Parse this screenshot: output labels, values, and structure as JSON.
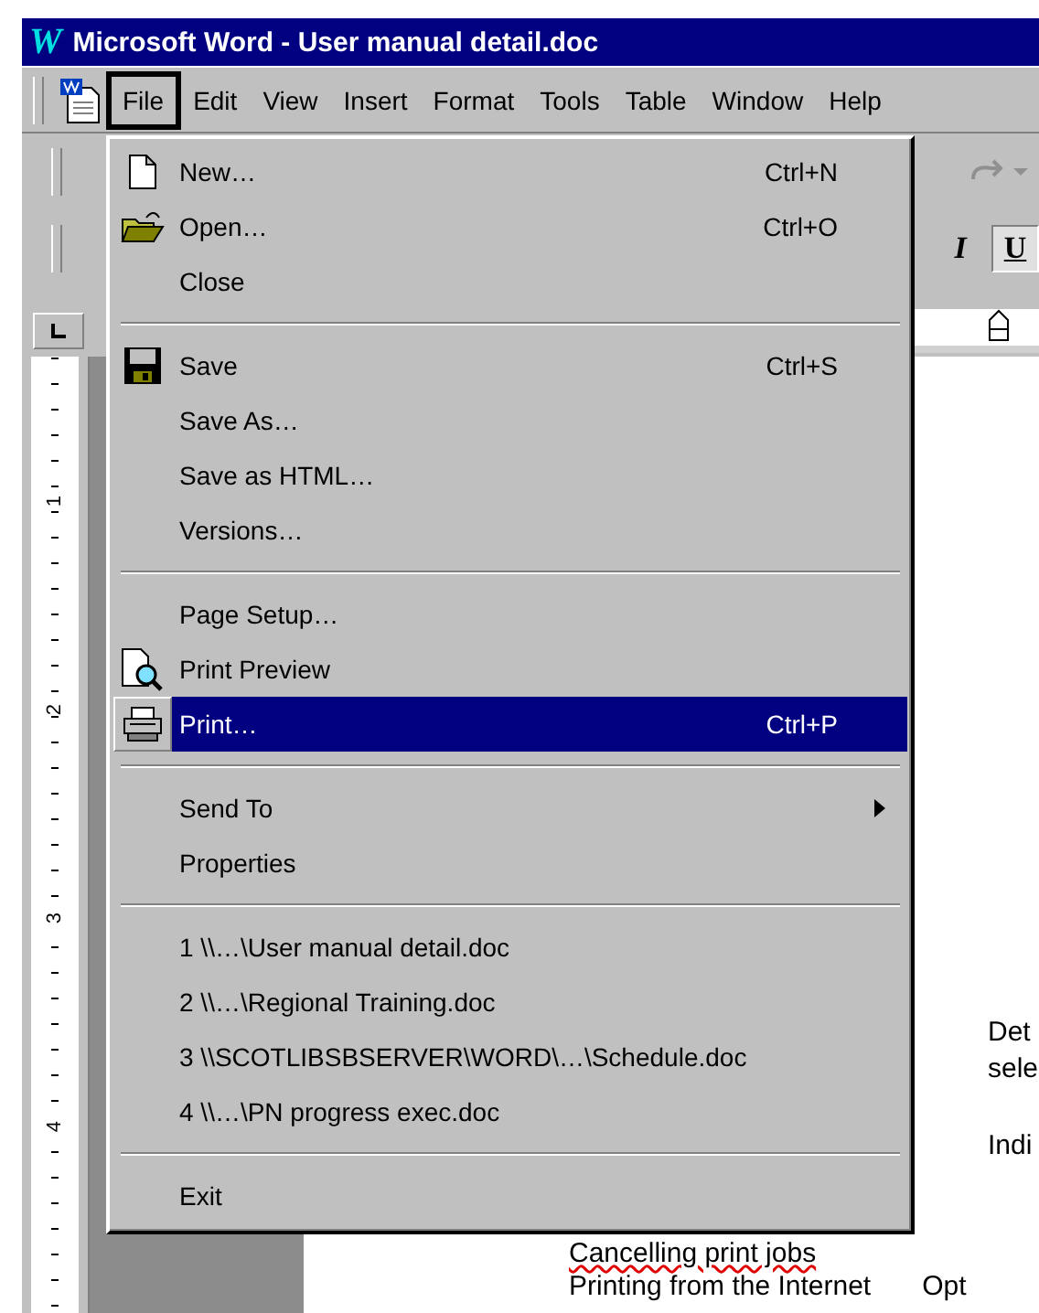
{
  "window": {
    "logo": "W",
    "title": "Microsoft Word - User manual detail.doc"
  },
  "menu_bar": [
    {
      "label": "File",
      "selected": true
    },
    {
      "label": "Edit",
      "selected": false
    },
    {
      "label": "View",
      "selected": false
    },
    {
      "label": "Insert",
      "selected": false
    },
    {
      "label": "Format",
      "selected": false
    },
    {
      "label": "Tools",
      "selected": false
    },
    {
      "label": "Table",
      "selected": false
    },
    {
      "label": "Window",
      "selected": false
    },
    {
      "label": "Help",
      "selected": false
    }
  ],
  "toolbar": {
    "format_buttons": [
      {
        "label": "I",
        "selected": false
      },
      {
        "label": "U",
        "selected": true
      }
    ]
  },
  "vertical_ruler": [
    "1",
    "2",
    "3",
    "4"
  ],
  "file_menu": {
    "groups": [
      [
        {
          "kind": "command",
          "label": "New…",
          "shortcut": "Ctrl+N",
          "selected": false
        },
        {
          "kind": "command",
          "label": "Open…",
          "shortcut": "Ctrl+O",
          "selected": false
        },
        {
          "kind": "command",
          "label": "Close",
          "selected": false
        }
      ],
      [
        {
          "kind": "command",
          "label": "Save",
          "shortcut": "Ctrl+S",
          "selected": false
        },
        {
          "kind": "command",
          "label": "Save As…",
          "selected": false
        },
        {
          "kind": "command",
          "label": "Save as HTML…",
          "selected": false
        },
        {
          "kind": "command",
          "label": "Versions…",
          "selected": false
        }
      ],
      [
        {
          "kind": "command",
          "label": "Page Setup…",
          "selected": false
        },
        {
          "kind": "command",
          "label": "Print Preview",
          "selected": false
        },
        {
          "kind": "command",
          "label": "Print…",
          "shortcut": "Ctrl+P",
          "selected": true
        }
      ],
      [
        {
          "kind": "submenu",
          "label": "Send To",
          "selected": false
        },
        {
          "kind": "command",
          "label": "Properties",
          "selected": false
        }
      ],
      [
        {
          "kind": "command",
          "label": "1 \\\\…\\User manual detail.doc",
          "selected": false
        },
        {
          "kind": "command",
          "label": "2 \\\\…\\Regional Training.doc",
          "selected": false
        },
        {
          "kind": "command",
          "label": "3 \\\\SCOTLIBSBSERVER\\WORD\\…\\Schedule.doc",
          "selected": false
        },
        {
          "kind": "command",
          "label": "4 \\\\…\\PN progress exec.doc",
          "selected": false
        }
      ],
      [
        {
          "kind": "command",
          "label": "Exit",
          "selected": false
        }
      ]
    ]
  },
  "document": {
    "side_text": [
      "Det",
      "sele",
      "Indi"
    ],
    "heading": {
      "text": "Cancelling print jobs",
      "misspelled": true
    },
    "bottom_row": [
      "Printing from the Internet",
      "Opt"
    ]
  }
}
